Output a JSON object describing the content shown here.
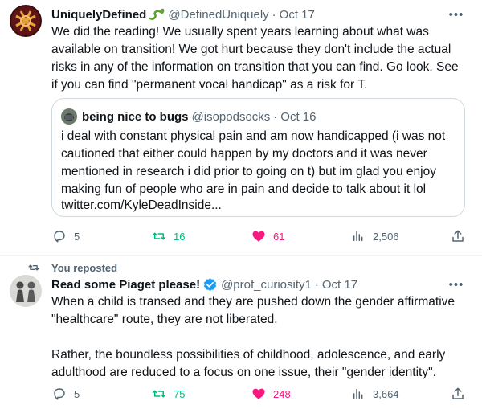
{
  "tweet1": {
    "name": "UniquelyDefined",
    "handle": "@DefinedUniquely",
    "dot": "·",
    "time": "Oct 17",
    "more": "•••",
    "lines": [
      "We did the reading! We usually spent years learning about what was",
      "available on transition! We got hurt because they don't include the actual",
      "risks in any of the information on transition that you can find. Go look. See",
      "if you can find \"permanent vocal handicap\" as a risk for T."
    ],
    "quote": {
      "name": "being nice to bugs",
      "handle": "@isopodsocks",
      "dot": "·",
      "time": "Oct 16",
      "lines": [
        "i deal with constant physical pain and am now handicapped (i was not",
        "cautioned that either could happen by my doctors and it was never",
        "mentioned in research i did prior to going on t) but im glad you enjoy",
        "making fun of people who are in pain and decide to talk about it lol",
        "twitter.com/KyleDeadInside..."
      ]
    },
    "actions": {
      "replies": "5",
      "reposts": "16",
      "likes": "61",
      "views": "2,506"
    }
  },
  "tweet2": {
    "repost_label": "You reposted",
    "name": "Read some Piaget please!",
    "handle": "@prof_curiosity1",
    "dot": "·",
    "time": "Oct 17",
    "more": "•••",
    "lines": [
      "When a child is transed and they are pushed down the gender affirmative",
      "\"healthcare\" route, they are not liberated.",
      "",
      "Rather, the boundless possibilities of childhood, adolescence, and early",
      "adulthood are reduced to a focus on one issue, their \"gender identity\"."
    ],
    "actions": {
      "replies": "5",
      "reposts": "75",
      "likes": "248",
      "views": "3,664"
    }
  },
  "colors": {
    "text": "#0f1419",
    "secondary": "#536471",
    "repost_green": "#00ba7c",
    "like_pink": "#f91880",
    "verified_blue": "#1d9bf0",
    "border": "#cfd9de"
  },
  "icons": [
    "reply-icon",
    "repost-icon",
    "like-icon",
    "views-icon",
    "share-icon",
    "more-icon",
    "verified-badge-icon",
    "snake-emoji-icon"
  ]
}
